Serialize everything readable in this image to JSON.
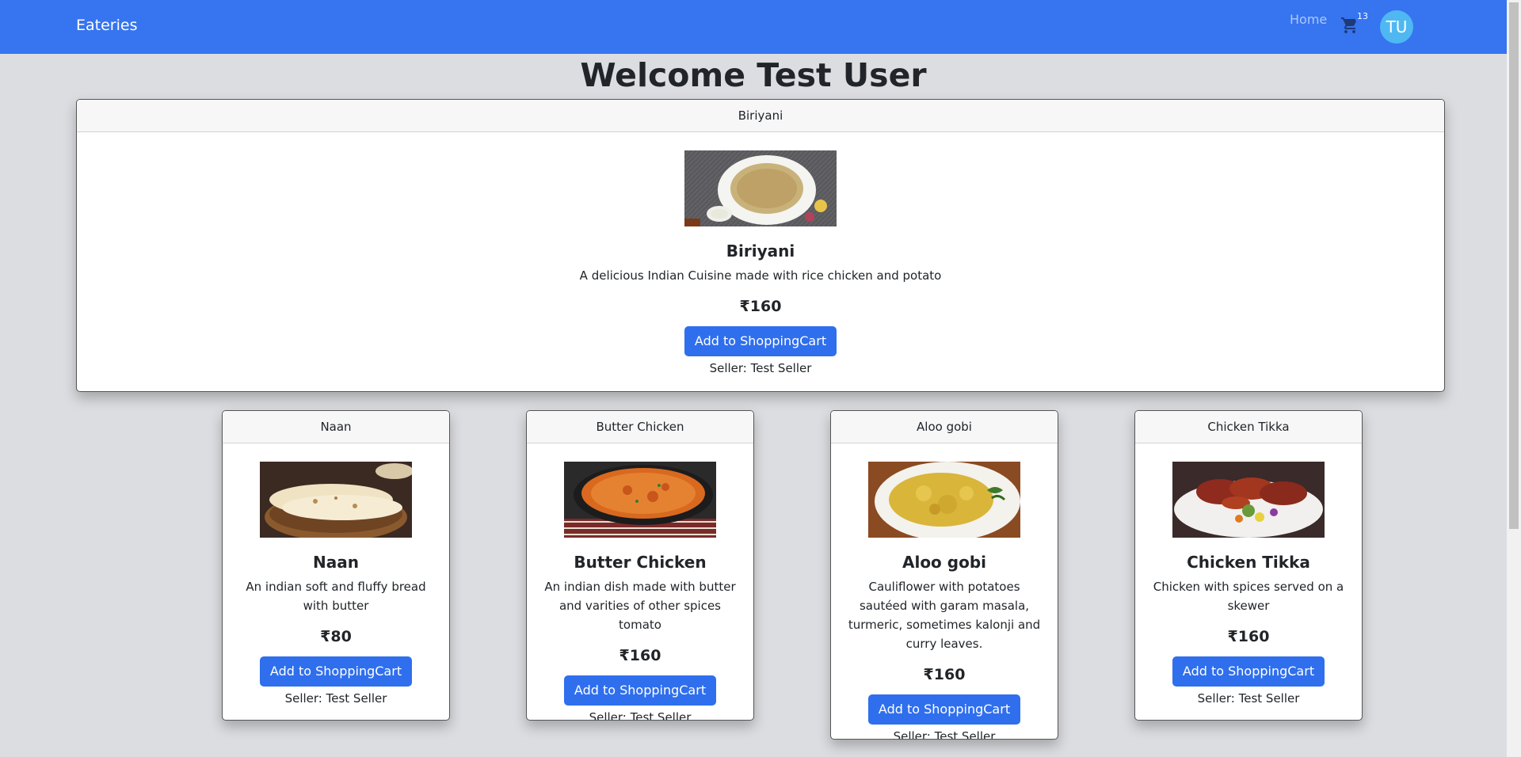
{
  "navbar": {
    "brand": "Eateries",
    "home_label": "Home",
    "cart_count": "13",
    "avatar_initials": "TU"
  },
  "page": {
    "welcome": "Welcome Test User"
  },
  "products": [
    {
      "header": "Biriyani",
      "title": "Biriyani",
      "description": "A delicious Indian Cuisine made with rice chicken and potato",
      "price": "₹160",
      "button": "Add to ShoppingCart",
      "seller": "Seller: Test Seller"
    },
    {
      "header": "Naan",
      "title": "Naan",
      "description": "An indian soft and fluffy bread with butter",
      "price": "₹80",
      "button": "Add to ShoppingCart",
      "seller": "Seller: Test Seller"
    },
    {
      "header": "Butter Chicken",
      "title": "Butter Chicken",
      "description": "An indian dish made with butter and varities of other spices tomato",
      "price": "₹160",
      "button": "Add to ShoppingCart",
      "seller": "Seller: Test Seller"
    },
    {
      "header": "Aloo gobi",
      "title": "Aloo gobi",
      "description": "Cauliflower with potatoes sautéed with garam masala, turmeric, sometimes kalonji and curry leaves.",
      "price": "₹160",
      "button": "Add to ShoppingCart",
      "seller": "Seller: Test Seller"
    },
    {
      "header": "Chicken Tikka",
      "title": "Chicken Tikka",
      "description": "Chicken with spices served on a skewer",
      "price": "₹160",
      "button": "Add to ShoppingCart",
      "seller": "Seller: Test Seller"
    }
  ],
  "colors": {
    "navbar": "#3674f0",
    "button": "#2f6fed",
    "background": "#dcdde1",
    "avatar": "#4fb8f2"
  },
  "icons": [
    "shopping-cart-icon"
  ]
}
